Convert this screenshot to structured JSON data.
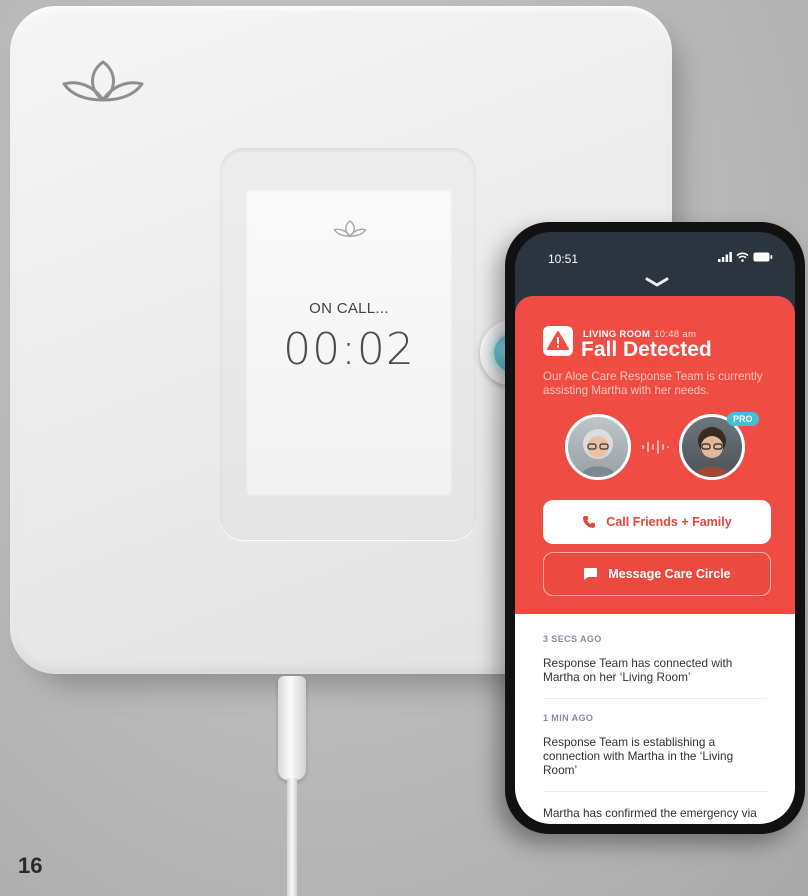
{
  "hub": {
    "logo": "lotus-logo",
    "screen": {
      "logo": "lotus-logo",
      "call_status": "ON CALL...",
      "call_timer": "00:02"
    },
    "button": {
      "icon": "call-light-button",
      "light_color": "#5ec3da"
    }
  },
  "page_number": "16",
  "phone": {
    "status_bar": {
      "time": "10:51",
      "icons": [
        "signal-icon",
        "wifi-icon",
        "battery-icon"
      ]
    },
    "alert": {
      "background_color": "#ef4d44",
      "icon": "warning-icon",
      "location": "LIVING ROOM",
      "time": "10:48 am",
      "title": "Fall Detected",
      "description": "Our Aloe Care Response Team is currently assisting Martha with her needs.",
      "avatars": [
        "martha-avatar",
        "responder-avatar"
      ],
      "pro_badge": "PRO",
      "call_button": "Call Friends + Family",
      "message_button": "Message Care Circle"
    },
    "feed": [
      {
        "time": "3 SECS AGO",
        "text": "Response Team has connected with Martha on her ‘Living Room’"
      },
      {
        "time": "1 MIN AGO",
        "text": "Response Team is establishing a connection with Martha in the ‘Living Room’"
      },
      {
        "time": "",
        "text": "Martha has confirmed the emergency via"
      }
    ]
  }
}
